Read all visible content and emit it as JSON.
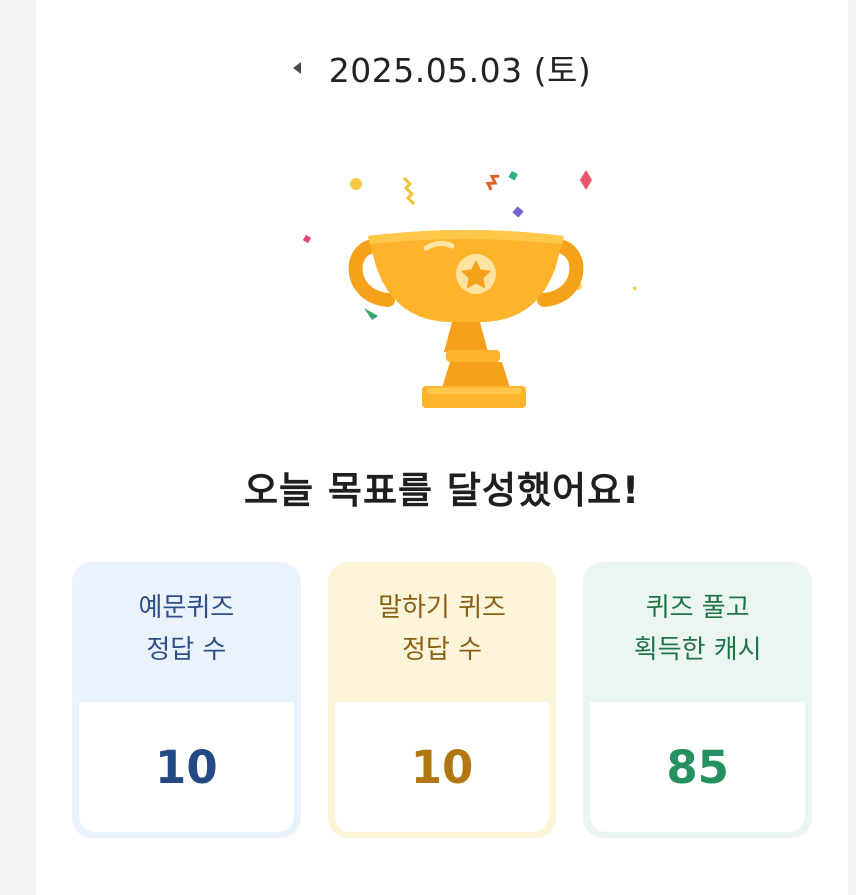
{
  "date_nav": {
    "date": "2025.05.03 (토)",
    "prev_icon": "chevron-left-icon"
  },
  "illustration": {
    "icon": "trophy-icon",
    "colors": {
      "gold": "#FDB42C",
      "gold_dark": "#F5A11A",
      "gold_light": "#FFD36B"
    }
  },
  "headline": "오늘 목표를 달성했어요!",
  "stats": [
    {
      "label_line1": "예문퀴즈",
      "label_line2": "정답 수",
      "value": "10",
      "color": "#244a86"
    },
    {
      "label_line1": "말하기 퀴즈",
      "label_line2": "정답 수",
      "value": "10",
      "color": "#b27711"
    },
    {
      "label_line1": "퀴즈 풀고",
      "label_line2": "획득한 캐시",
      "value": "85",
      "color": "#259060"
    }
  ]
}
